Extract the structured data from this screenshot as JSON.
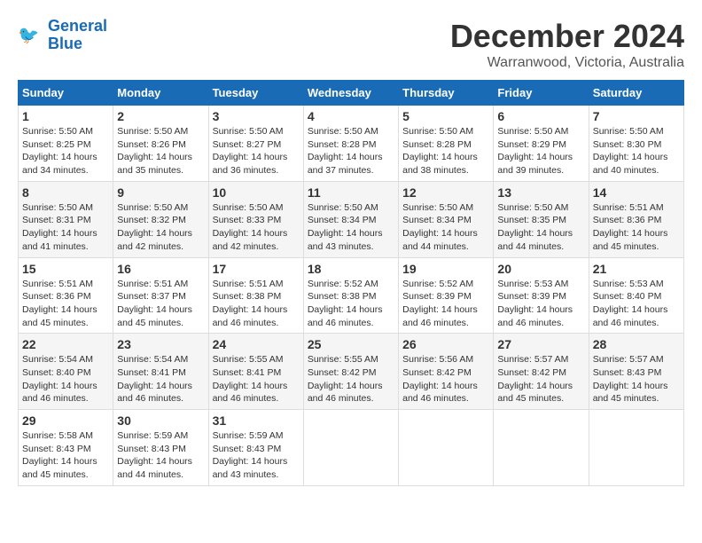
{
  "logo": {
    "line1": "General",
    "line2": "Blue"
  },
  "title": "December 2024",
  "subtitle": "Warranwood, Victoria, Australia",
  "days_header": [
    "Sunday",
    "Monday",
    "Tuesday",
    "Wednesday",
    "Thursday",
    "Friday",
    "Saturday"
  ],
  "weeks": [
    [
      {
        "day": "1",
        "sunrise": "5:50 AM",
        "sunset": "8:25 PM",
        "daylight": "14 hours and 34 minutes."
      },
      {
        "day": "2",
        "sunrise": "5:50 AM",
        "sunset": "8:26 PM",
        "daylight": "14 hours and 35 minutes."
      },
      {
        "day": "3",
        "sunrise": "5:50 AM",
        "sunset": "8:27 PM",
        "daylight": "14 hours and 36 minutes."
      },
      {
        "day": "4",
        "sunrise": "5:50 AM",
        "sunset": "8:28 PM",
        "daylight": "14 hours and 37 minutes."
      },
      {
        "day": "5",
        "sunrise": "5:50 AM",
        "sunset": "8:28 PM",
        "daylight": "14 hours and 38 minutes."
      },
      {
        "day": "6",
        "sunrise": "5:50 AM",
        "sunset": "8:29 PM",
        "daylight": "14 hours and 39 minutes."
      },
      {
        "day": "7",
        "sunrise": "5:50 AM",
        "sunset": "8:30 PM",
        "daylight": "14 hours and 40 minutes."
      }
    ],
    [
      {
        "day": "8",
        "sunrise": "5:50 AM",
        "sunset": "8:31 PM",
        "daylight": "14 hours and 41 minutes."
      },
      {
        "day": "9",
        "sunrise": "5:50 AM",
        "sunset": "8:32 PM",
        "daylight": "14 hours and 42 minutes."
      },
      {
        "day": "10",
        "sunrise": "5:50 AM",
        "sunset": "8:33 PM",
        "daylight": "14 hours and 42 minutes."
      },
      {
        "day": "11",
        "sunrise": "5:50 AM",
        "sunset": "8:34 PM",
        "daylight": "14 hours and 43 minutes."
      },
      {
        "day": "12",
        "sunrise": "5:50 AM",
        "sunset": "8:34 PM",
        "daylight": "14 hours and 44 minutes."
      },
      {
        "day": "13",
        "sunrise": "5:50 AM",
        "sunset": "8:35 PM",
        "daylight": "14 hours and 44 minutes."
      },
      {
        "day": "14",
        "sunrise": "5:51 AM",
        "sunset": "8:36 PM",
        "daylight": "14 hours and 45 minutes."
      }
    ],
    [
      {
        "day": "15",
        "sunrise": "5:51 AM",
        "sunset": "8:36 PM",
        "daylight": "14 hours and 45 minutes."
      },
      {
        "day": "16",
        "sunrise": "5:51 AM",
        "sunset": "8:37 PM",
        "daylight": "14 hours and 45 minutes."
      },
      {
        "day": "17",
        "sunrise": "5:51 AM",
        "sunset": "8:38 PM",
        "daylight": "14 hours and 46 minutes."
      },
      {
        "day": "18",
        "sunrise": "5:52 AM",
        "sunset": "8:38 PM",
        "daylight": "14 hours and 46 minutes."
      },
      {
        "day": "19",
        "sunrise": "5:52 AM",
        "sunset": "8:39 PM",
        "daylight": "14 hours and 46 minutes."
      },
      {
        "day": "20",
        "sunrise": "5:53 AM",
        "sunset": "8:39 PM",
        "daylight": "14 hours and 46 minutes."
      },
      {
        "day": "21",
        "sunrise": "5:53 AM",
        "sunset": "8:40 PM",
        "daylight": "14 hours and 46 minutes."
      }
    ],
    [
      {
        "day": "22",
        "sunrise": "5:54 AM",
        "sunset": "8:40 PM",
        "daylight": "14 hours and 46 minutes."
      },
      {
        "day": "23",
        "sunrise": "5:54 AM",
        "sunset": "8:41 PM",
        "daylight": "14 hours and 46 minutes."
      },
      {
        "day": "24",
        "sunrise": "5:55 AM",
        "sunset": "8:41 PM",
        "daylight": "14 hours and 46 minutes."
      },
      {
        "day": "25",
        "sunrise": "5:55 AM",
        "sunset": "8:42 PM",
        "daylight": "14 hours and 46 minutes."
      },
      {
        "day": "26",
        "sunrise": "5:56 AM",
        "sunset": "8:42 PM",
        "daylight": "14 hours and 46 minutes."
      },
      {
        "day": "27",
        "sunrise": "5:57 AM",
        "sunset": "8:42 PM",
        "daylight": "14 hours and 45 minutes."
      },
      {
        "day": "28",
        "sunrise": "5:57 AM",
        "sunset": "8:43 PM",
        "daylight": "14 hours and 45 minutes."
      }
    ],
    [
      {
        "day": "29",
        "sunrise": "5:58 AM",
        "sunset": "8:43 PM",
        "daylight": "14 hours and 45 minutes."
      },
      {
        "day": "30",
        "sunrise": "5:59 AM",
        "sunset": "8:43 PM",
        "daylight": "14 hours and 44 minutes."
      },
      {
        "day": "31",
        "sunrise": "5:59 AM",
        "sunset": "8:43 PM",
        "daylight": "14 hours and 43 minutes."
      },
      null,
      null,
      null,
      null
    ]
  ],
  "labels": {
    "sunrise": "Sunrise:",
    "sunset": "Sunset:",
    "daylight": "Daylight:"
  }
}
